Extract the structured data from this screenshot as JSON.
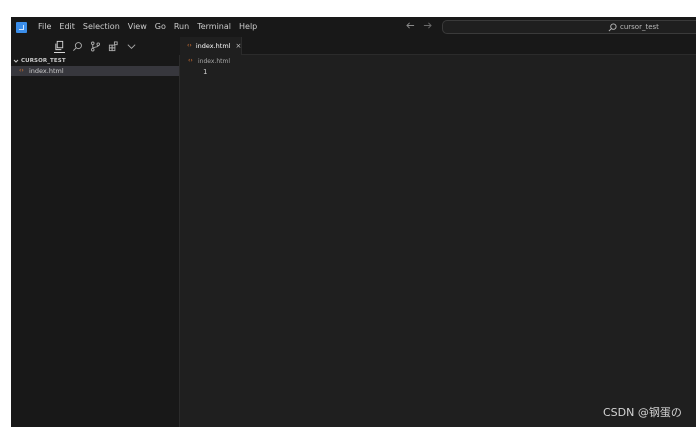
{
  "menu": {
    "items": [
      "File",
      "Edit",
      "Selection",
      "View",
      "Go",
      "Run",
      "Terminal",
      "Help"
    ]
  },
  "nav": {
    "back_icon": "arrow-left-icon",
    "forward_icon": "arrow-right-icon"
  },
  "command_center": {
    "text": "cursor_test",
    "icon": "search-icon"
  },
  "activity_bar": {
    "icons": [
      "files-icon",
      "search-icon",
      "source-control-icon",
      "extensions-icon",
      "chevron-down-icon"
    ]
  },
  "explorer": {
    "section_title": "CURSOR_TEST",
    "files": [
      {
        "name": "index.html",
        "icon": "html-file-icon",
        "selected": true
      }
    ]
  },
  "editor": {
    "tab": {
      "label": "index.html",
      "close_symbol": "×"
    },
    "breadcrumb": "index.html",
    "line_numbers": [
      "1"
    ]
  },
  "watermark": {
    "text": "CSDN @钢蛋の"
  },
  "colors": {
    "background": "#1e1e1e",
    "sidebar": "#181818",
    "selection": "#37373d",
    "html_icon": "#e37933",
    "logo": "#3b8eea"
  }
}
